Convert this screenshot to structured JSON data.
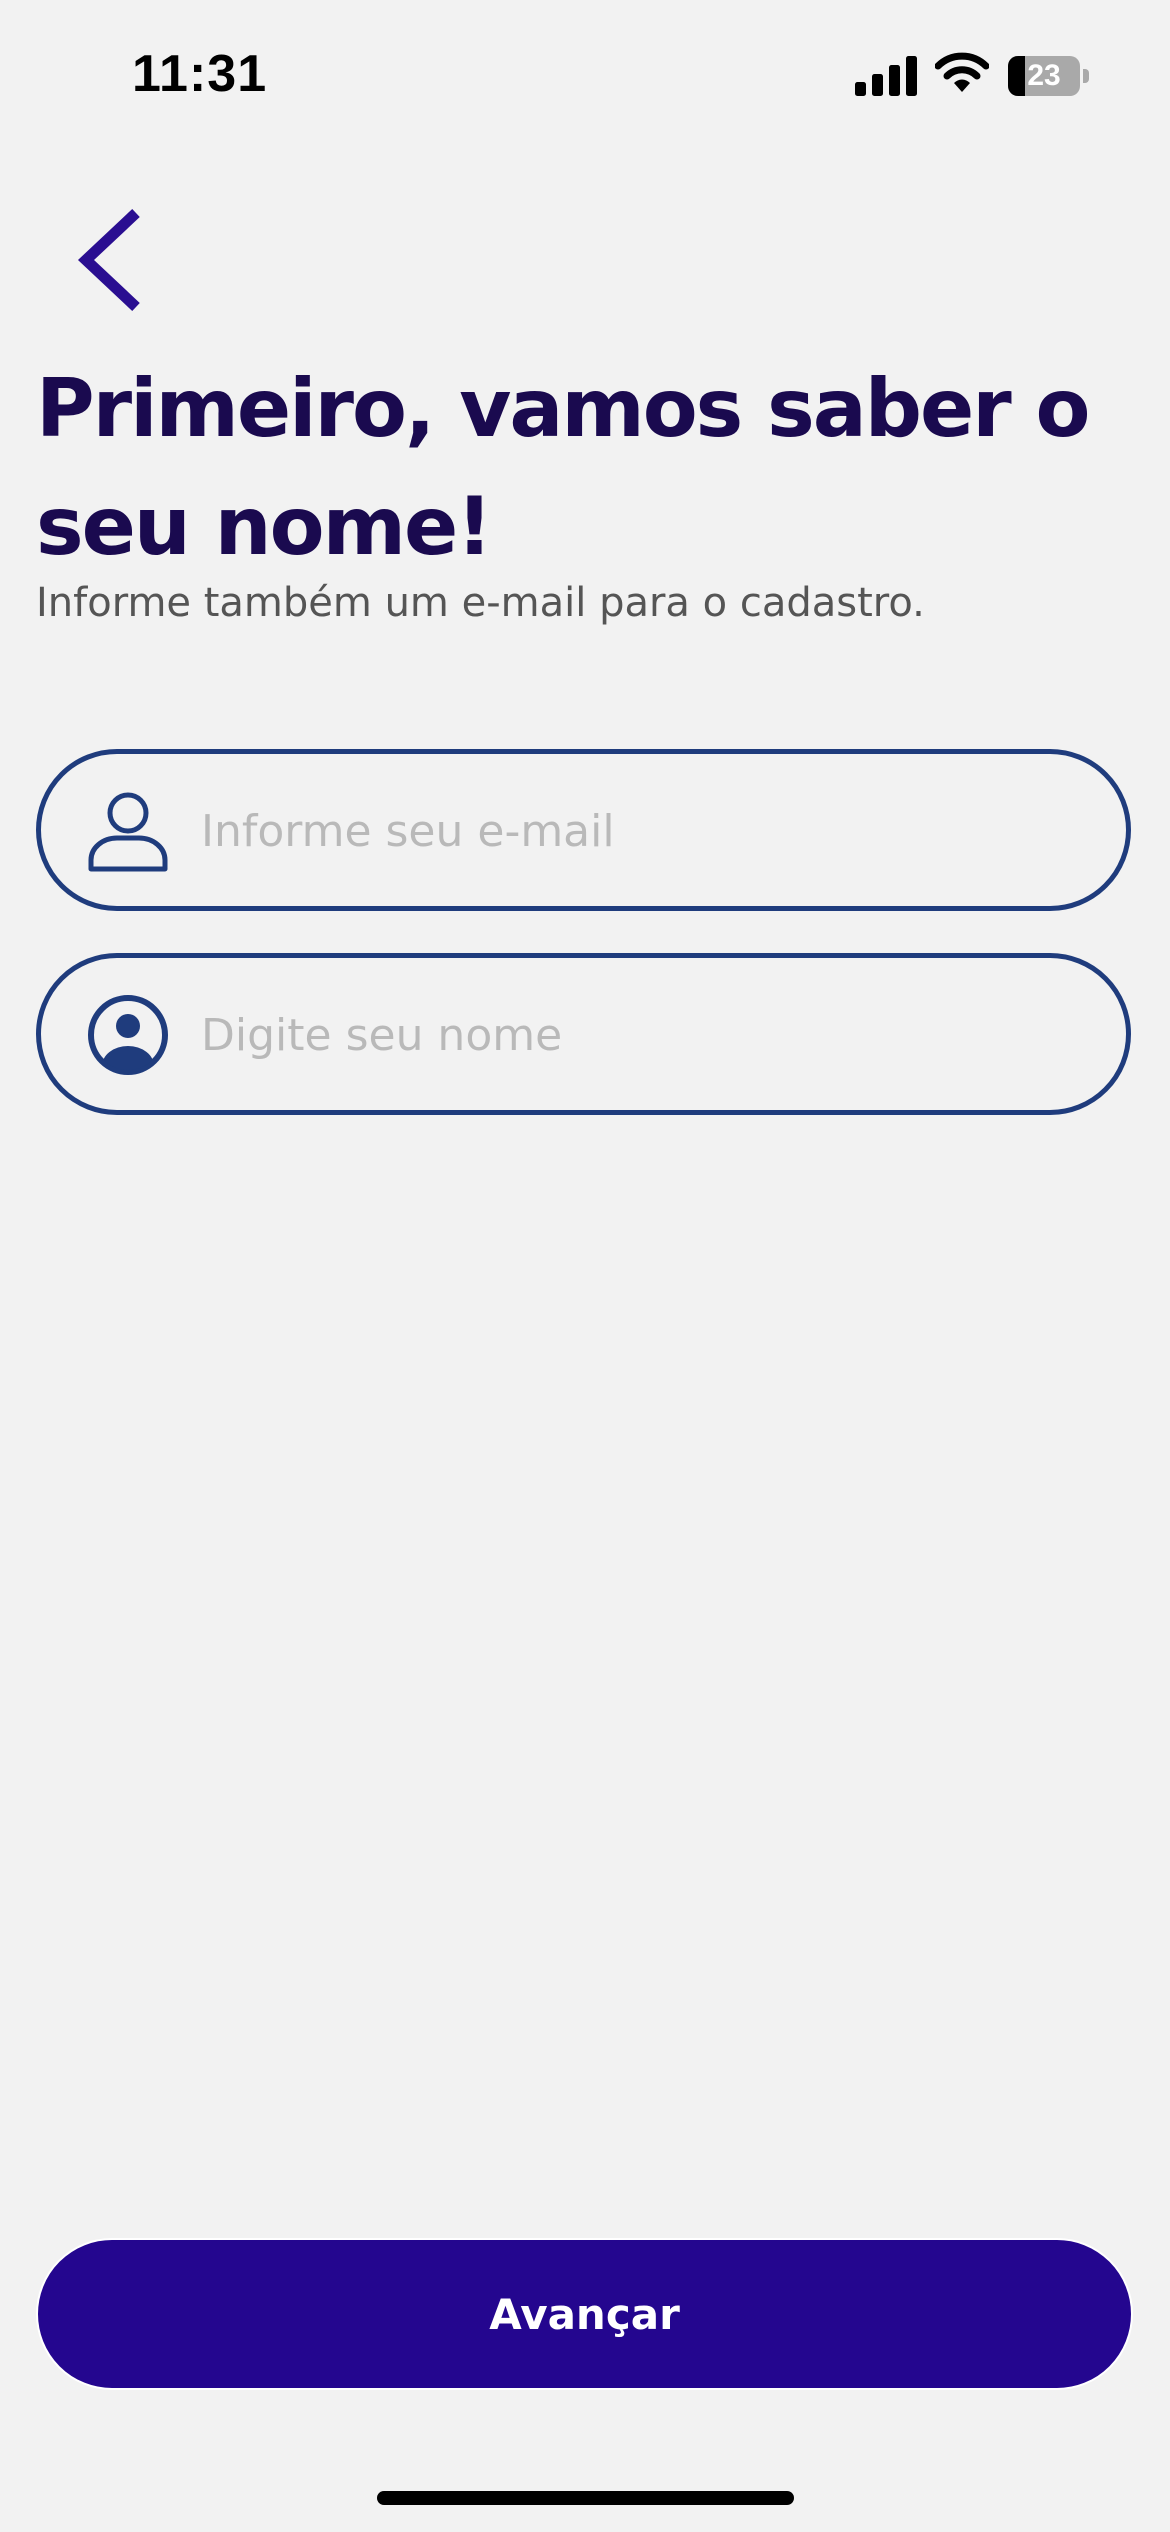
{
  "status_bar": {
    "time": "11:31",
    "battery_level": "23",
    "icons": [
      "signal-icon",
      "wifi-icon",
      "battery-icon"
    ]
  },
  "nav": {
    "back_icon": "chevron-left-icon",
    "back_color": "#2a0e91"
  },
  "header": {
    "title": "Primeiro, vamos saber o seu nome!",
    "subtitle": "Informe também um e-mail para o cadastro."
  },
  "form": {
    "email": {
      "icon": "user-outline-icon",
      "value": "",
      "placeholder": "Informe seu e-mail"
    },
    "name": {
      "icon": "user-circle-icon",
      "value": "",
      "placeholder": "Digite seu nome"
    }
  },
  "actions": {
    "next_label": "Avançar"
  },
  "colors": {
    "background": "#f2f2f2",
    "title": "#1a0a4f",
    "field_border": "#1f3c7d",
    "primary_button": "#24068f",
    "placeholder": "#b9b9b9"
  }
}
